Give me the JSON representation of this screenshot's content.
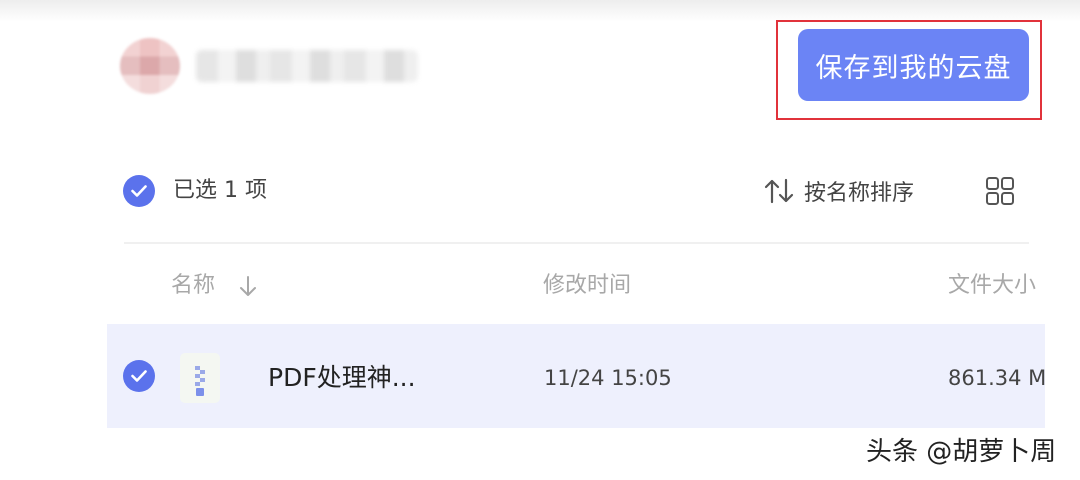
{
  "header": {
    "save_button_label": "保存到我的云盘"
  },
  "toolbar": {
    "selection_count_text": "已选 1 项",
    "sort_label": "按名称排序",
    "view_toggle_icon": "grid-view-icon"
  },
  "file_list": {
    "columns": [
      "名称",
      "修改时间",
      "文件大小"
    ],
    "rows": [
      {
        "name": "PDF处理神...",
        "modified": "11/24 15:05",
        "size": "861.34 M",
        "selected": true,
        "icon": "zip-file-icon"
      }
    ]
  },
  "watermark": {
    "text": "头条 @胡萝卜周"
  },
  "colors": {
    "accent": "#6b84f5",
    "check": "#5b72ec",
    "selected_row": "#eef0fd",
    "highlight_border": "#e1323b"
  }
}
